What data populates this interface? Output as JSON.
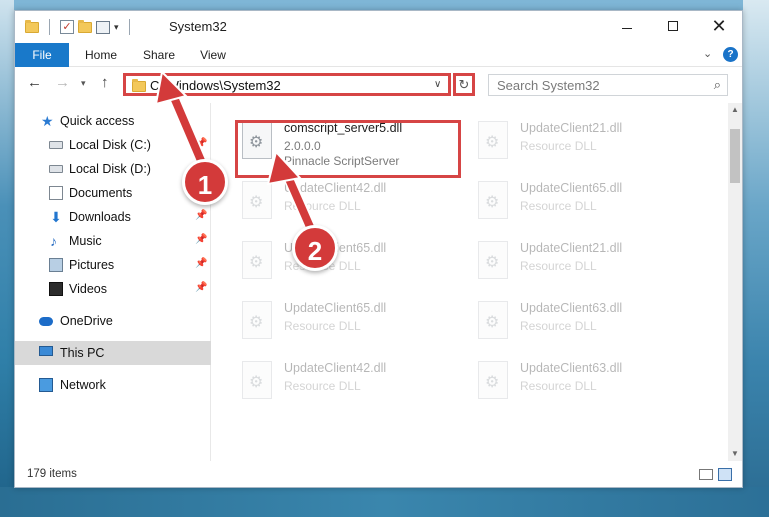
{
  "window": {
    "title": "System32",
    "controls": {
      "minimize": "—",
      "maximize": "",
      "close": "✕"
    }
  },
  "ribbon": {
    "tabs": [
      "File",
      "Home",
      "Share",
      "View"
    ],
    "help": "?"
  },
  "address": {
    "path": "C:\\Windows\\System32",
    "search_placeholder": "Search System32",
    "refresh": "↻"
  },
  "sidebar": {
    "items": [
      {
        "label": "Quick access",
        "icon": "star-icon",
        "pinned": false
      },
      {
        "label": "Local Disk (C:)",
        "icon": "drive-icon",
        "pinned": true
      },
      {
        "label": "Local Disk (D:)",
        "icon": "drive-icon",
        "pinned": false
      },
      {
        "label": "Documents",
        "icon": "documents-icon",
        "pinned": false
      },
      {
        "label": "Downloads",
        "icon": "downloads-icon",
        "pinned": true
      },
      {
        "label": "Music",
        "icon": "music-icon",
        "pinned": true
      },
      {
        "label": "Pictures",
        "icon": "pictures-icon",
        "pinned": true
      },
      {
        "label": "Videos",
        "icon": "videos-icon",
        "pinned": true
      },
      {
        "label": "OneDrive",
        "icon": "onedrive-icon",
        "pinned": false
      },
      {
        "label": "This PC",
        "icon": "this-pc-icon",
        "pinned": false,
        "selected": true
      },
      {
        "label": "Network",
        "icon": "network-icon",
        "pinned": false
      }
    ],
    "pin_glyph": "📌"
  },
  "files": {
    "highlighted": {
      "name": "comscript_server5.dll",
      "version": "2.0.0.0",
      "description": "Pinnacle ScriptServer"
    },
    "others": [
      {
        "name": "UpdateClient21.dll",
        "type": "Resource DLL"
      },
      {
        "name": "UpdateClient42.dll",
        "type": "Resource DLL"
      },
      {
        "name": "UpdateClient65.dll",
        "type": "Resource DLL"
      },
      {
        "name": "UpdateClient65.dll",
        "type": "Resource DLL"
      },
      {
        "name": "UpdateClient21.dll",
        "type": "Resource DLL"
      },
      {
        "name": "UpdateClient65.dll",
        "type": "Resource DLL"
      },
      {
        "name": "UpdateClient63.dll",
        "type": "Resource DLL"
      },
      {
        "name": "UpdateClient42.dll",
        "type": "Resource DLL"
      },
      {
        "name": "UpdateClient63.dll",
        "type": "Resource DLL"
      }
    ]
  },
  "status": {
    "item_count": "179 items"
  },
  "annotations": {
    "callout_1": "1",
    "callout_2": "2",
    "color": "#d33a3a"
  }
}
